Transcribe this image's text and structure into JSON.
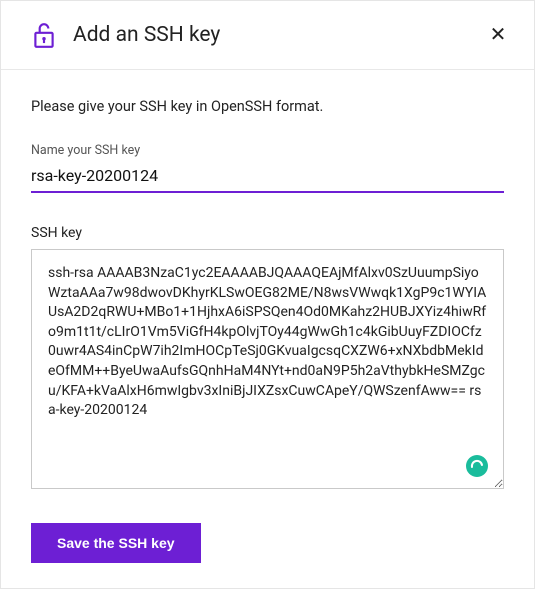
{
  "header": {
    "title": "Add an SSH key",
    "icon": "lock-open-icon",
    "close_label": "✕"
  },
  "body": {
    "instruction": "Please give your SSH key in OpenSSH format.",
    "name_field": {
      "label": "Name your SSH key",
      "value": "rsa-key-20200124"
    },
    "ssh_field": {
      "label": "SSH key",
      "value": "ssh-rsa AAAAB3NzaC1yc2EAAAABJQAAAQEAjMfAlxv0SzUuumpSiyoWztaAAa7w98dwovDKhyrKLSwOEG82ME/N8wsVWwqk1XgP9c1WYIAUsA2D2qRWU+MBo1+1HjhxA6iSPSQen4Od0MKahz2HUBJXYiz4hiwRfo9m1t1t/cLIrO1Vm5ViGfH4kpOlvjTOy44gWwGh1c4kGibUuyFZDIOCfz0uwr4AS4inCpW7ih2ImHOCpTeSj0GKvuaIgcsqCXZW6+xNXbdbMekIdeOfMM++ByeUwaAufsGQnhHaM4NYt+nd0aN9P5h2aVthybkHeSMZgcu/KFA+kVaAlxH6mwIgbv3xIniBjJIXZsxCuwCApeY/QWSzenfAww== rsa-key-20200124"
    },
    "save_button_label": "Save the SSH key"
  },
  "colors": {
    "accent": "#6d1fd4",
    "badge": "#1abc9c"
  }
}
